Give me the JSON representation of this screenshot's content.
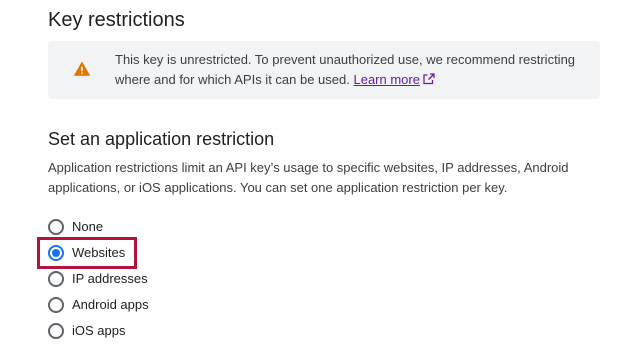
{
  "key_restrictions": {
    "title": "Key restrictions",
    "warning": {
      "icon": "warning-icon",
      "text": "This key is unrestricted. To prevent unauthorized use, we recommend restricting where and for which APIs it can be used.",
      "link_label": "Learn more",
      "link_icon": "external-link-icon"
    }
  },
  "application_restriction": {
    "title": "Set an application restriction",
    "description": "Application restrictions limit an API key’s usage to specific websites, IP addresses, Android applications, or iOS applications. You can set one application restriction per key.",
    "options": [
      {
        "label": "None",
        "checked": false
      },
      {
        "label": "Websites",
        "checked": true
      },
      {
        "label": "IP addresses",
        "checked": false
      },
      {
        "label": "Android apps",
        "checked": false
      },
      {
        "label": "iOS apps",
        "checked": false
      }
    ],
    "selected": "Websites"
  },
  "colors": {
    "accent": "#1a73e8",
    "warning": "#e37400",
    "highlight": "#b3123b",
    "link": "#681da8"
  }
}
